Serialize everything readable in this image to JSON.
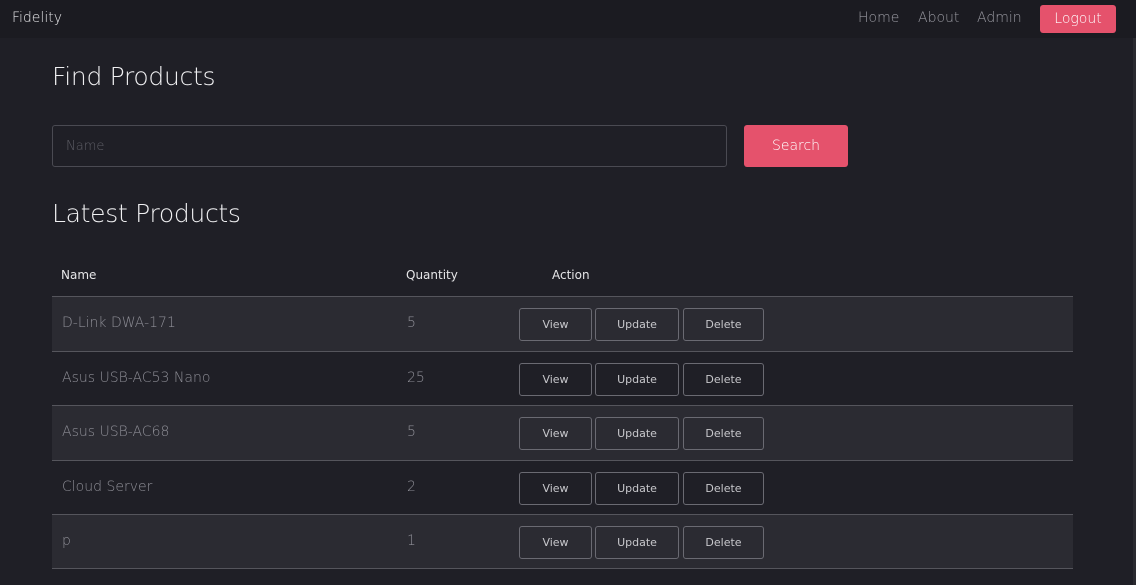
{
  "navbar": {
    "brand": "Fidelity",
    "links": [
      "Home",
      "About",
      "Admin"
    ],
    "logout_label": "Logout"
  },
  "search": {
    "title": "Find Products",
    "placeholder": "Name",
    "button_label": "Search"
  },
  "products": {
    "title": "Latest Products",
    "columns": [
      "Name",
      "Quantity",
      "Action"
    ],
    "rows": [
      {
        "name": "D-Link DWA-171",
        "quantity": "5"
      },
      {
        "name": "Asus USB-AC53 Nano",
        "quantity": "25"
      },
      {
        "name": "Asus USB-AC68",
        "quantity": "5"
      },
      {
        "name": "Cloud Server",
        "quantity": "2"
      },
      {
        "name": "p",
        "quantity": "1"
      }
    ],
    "actions": {
      "view": "View",
      "update": "Update",
      "delete": "Delete"
    }
  },
  "colors": {
    "accent": "#e5526c",
    "background": "#1f1f26",
    "row_alt": "#2b2b32"
  }
}
